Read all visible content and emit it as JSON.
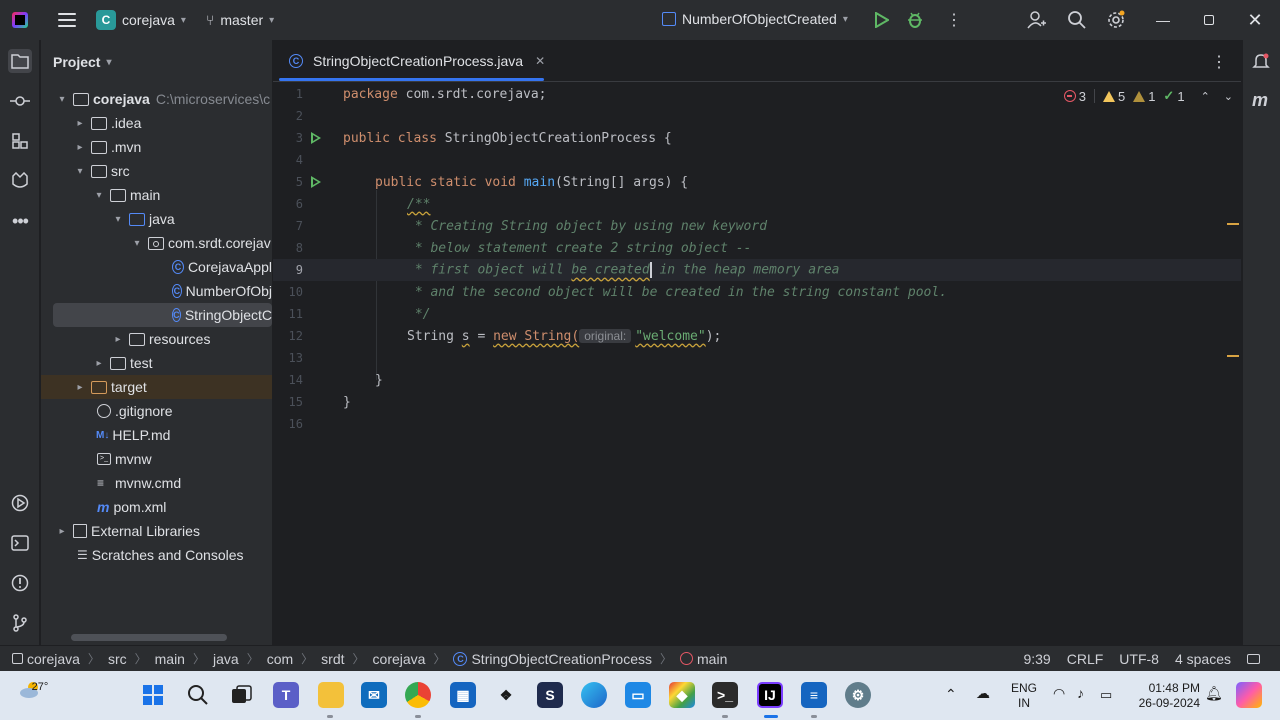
{
  "titlebar": {
    "project_badge": "C",
    "project_name": "corejava",
    "branch": "master",
    "run_config": "NumberOfObjectCreated"
  },
  "project_panel": {
    "title": "Project",
    "root": {
      "name": "corejava",
      "path": "C:\\microservices\\c"
    },
    "items": [
      {
        "label": ".idea"
      },
      {
        "label": ".mvn"
      },
      {
        "label": "src"
      },
      {
        "label": "main"
      },
      {
        "label": "java"
      },
      {
        "label": "com.srdt.corejav"
      },
      {
        "label": "CorejavaAppl"
      },
      {
        "label": "NumberOfObj"
      },
      {
        "label": "StringObjectC"
      },
      {
        "label": "resources"
      },
      {
        "label": "test"
      },
      {
        "label": "target"
      },
      {
        "label": ".gitignore"
      },
      {
        "label": "HELP.md"
      },
      {
        "label": "mvnw"
      },
      {
        "label": "mvnw.cmd"
      },
      {
        "label": "pom.xml"
      },
      {
        "label": "External Libraries"
      },
      {
        "label": "Scratches and Consoles"
      }
    ]
  },
  "editor": {
    "tab": {
      "title": "StringObjectCreationProcess.java"
    },
    "inspections": {
      "errors": "3",
      "warnings": "5",
      "weak_warnings": "1",
      "ok": "1"
    },
    "lines": {
      "l1_kw": "package",
      "l1_rest": " com.srdt.corejava;",
      "l3_kw": "public class",
      "l3_rest": " StringObjectCreationProcess {",
      "l5_kw": "public static void",
      "l5_fn": "main",
      "l5_rest": "(String[] args) {",
      "l6": "/**",
      "l7": " * Creating String object by using new keyword",
      "l8": " * below statement create 2 string object --",
      "l9a": " * first object will ",
      "l9b": "be created",
      "l9c": " in the heap memory area",
      "l10": " * and the second object will be created in the string constant pool.",
      "l11": " */",
      "l12_type": "String ",
      "l12_var": "s",
      "l12_eq": " = ",
      "l12_new": "new String(",
      "l12_hint": "original:",
      "l12_str": "\"welcome\"",
      "l12_end": ");",
      "l14": "}",
      "l15": "}"
    },
    "line_numbers": [
      "1",
      "2",
      "3",
      "4",
      "5",
      "6",
      "7",
      "8",
      "9",
      "10",
      "11",
      "12",
      "13",
      "14",
      "15",
      "16"
    ]
  },
  "statusbar": {
    "breadcrumbs": [
      "corejava",
      "src",
      "main",
      "java",
      "com",
      "srdt",
      "corejava",
      "StringObjectCreationProcess",
      "main"
    ],
    "position": "9:39",
    "line_ending": "CRLF",
    "encoding": "UTF-8",
    "indent": "4 spaces"
  },
  "taskbar": {
    "weather": "27°",
    "lang_1": "ENG",
    "lang_2": "IN",
    "time": "01:48 PM",
    "date": "26-09-2024"
  }
}
